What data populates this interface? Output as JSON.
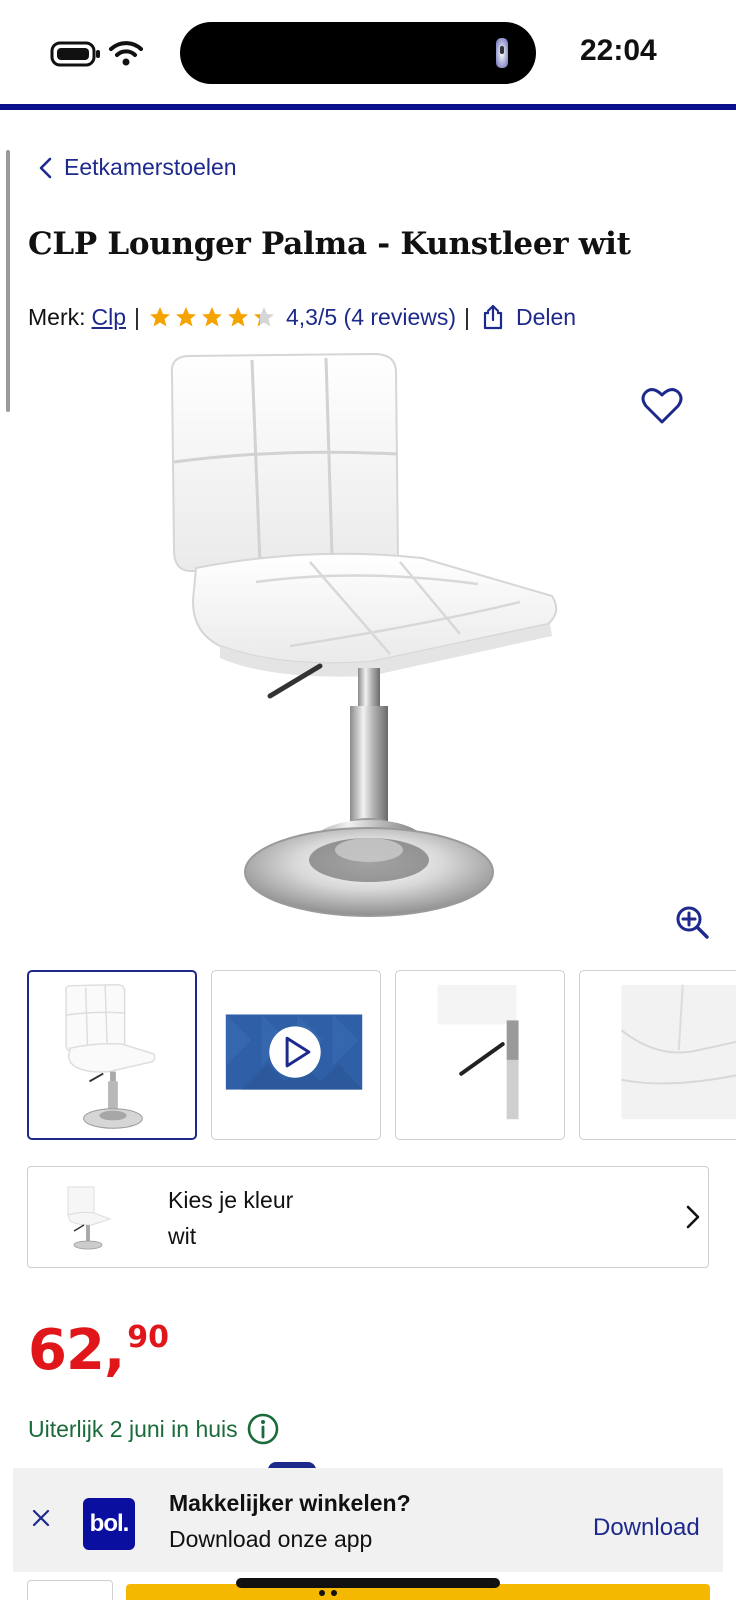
{
  "status_bar": {
    "time": "22:04"
  },
  "breadcrumb": {
    "label": "Eetkamerstoelen"
  },
  "product": {
    "title": "CLP Lounger Palma - Kunstleer wit",
    "brand_label": "Merk:",
    "brand": "Clp",
    "separator": "|",
    "rating_text": "4,3/5 (4 reviews)",
    "rating_value": 4.3,
    "rating_max": 5,
    "share_label": "Delen",
    "icons": {
      "wishlist": "heart-icon",
      "zoom": "zoom-in-icon",
      "share": "share-icon",
      "back": "chevron-left-icon"
    }
  },
  "thumbnails": [
    {
      "name": "thumbnail-chair-front",
      "kind": "image",
      "selected": true
    },
    {
      "name": "thumbnail-video",
      "kind": "video",
      "selected": false
    },
    {
      "name": "thumbnail-lever-detail",
      "kind": "image",
      "selected": false
    },
    {
      "name": "thumbnail-seat-detail",
      "kind": "image",
      "selected": false
    }
  ],
  "color_selector": {
    "label": "Kies je kleur",
    "value": "wit"
  },
  "price": {
    "main": "62",
    "cents": "90",
    "color": "#e0161b"
  },
  "delivery": {
    "text": "Uiterlijk 2 juni in huis",
    "color": "#1a6a3a"
  },
  "app_banner": {
    "logo_text": "bol.",
    "headline": "Makkelijker winkelen?",
    "subtext": "Download onze app",
    "cta": "Download"
  },
  "colors": {
    "brand_blue": "#1d2a8c",
    "top_rule": "#0a0f8c",
    "star_orange": "#f5a300",
    "cta_yellow": "#f5b800"
  }
}
